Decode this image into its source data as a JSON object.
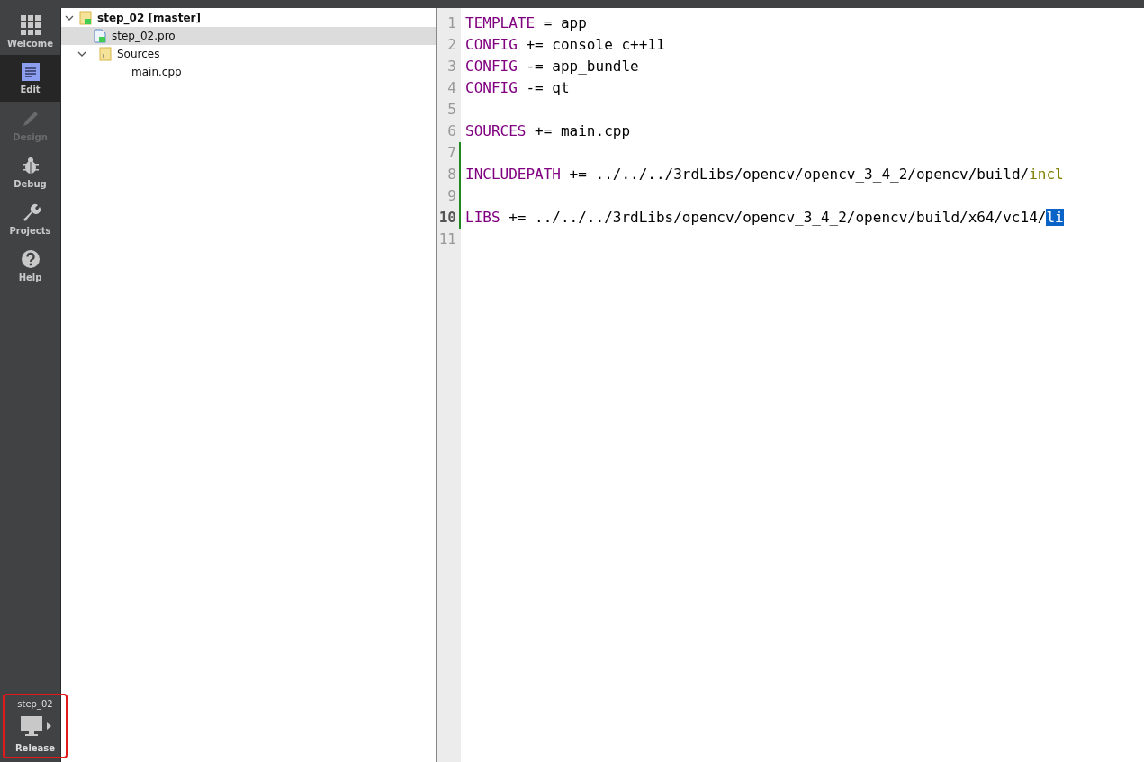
{
  "modes": [
    {
      "label": "Welcome",
      "kind": "grid",
      "selected": false,
      "disabled": false
    },
    {
      "label": "Edit",
      "kind": "edit",
      "selected": true,
      "disabled": false
    },
    {
      "label": "Design",
      "kind": "pencil",
      "selected": false,
      "disabled": true
    },
    {
      "label": "Debug",
      "kind": "bug",
      "selected": false,
      "disabled": false
    },
    {
      "label": "Projects",
      "kind": "wrench",
      "selected": false,
      "disabled": false
    },
    {
      "label": "Help",
      "kind": "help",
      "selected": false,
      "disabled": false
    }
  ],
  "kit": {
    "project": "step_02",
    "build": "Release",
    "highlighted": true
  },
  "project_tree": [
    {
      "label": "step_02 [master]",
      "expanded": true,
      "selected": false,
      "children": [
        {
          "label": "step_02.pro",
          "kind": "file",
          "selected": true
        },
        {
          "label": "Sources",
          "kind": "folder",
          "expanded": true,
          "selected": false,
          "children": [
            {
              "label": "main.cpp",
              "selected": false
            }
          ]
        }
      ]
    }
  ],
  "editor": {
    "lines": [
      {
        "number": "1",
        "current": false,
        "changed": false,
        "segments": [
          {
            "kind": "keyword",
            "text": "TEMPLATE"
          },
          {
            "kind": "plain",
            "text": " = app"
          }
        ]
      },
      {
        "number": "2",
        "current": false,
        "changed": false,
        "segments": [
          {
            "kind": "keyword",
            "text": "CONFIG"
          },
          {
            "kind": "plain",
            "text": " += console c++11"
          }
        ]
      },
      {
        "number": "3",
        "current": false,
        "changed": false,
        "segments": [
          {
            "kind": "keyword",
            "text": "CONFIG"
          },
          {
            "kind": "plain",
            "text": " -= app_bundle"
          }
        ]
      },
      {
        "number": "4",
        "current": false,
        "changed": false,
        "segments": [
          {
            "kind": "keyword",
            "text": "CONFIG"
          },
          {
            "kind": "plain",
            "text": " -= qt"
          }
        ]
      },
      {
        "number": "5",
        "current": false,
        "changed": false
      },
      {
        "number": "6",
        "current": false,
        "changed": false,
        "segments": [
          {
            "kind": "keyword",
            "text": "SOURCES"
          },
          {
            "kind": "plain",
            "text": " += main.cpp"
          }
        ]
      },
      {
        "number": "7",
        "current": false,
        "changed": true
      },
      {
        "number": "8",
        "current": false,
        "changed": true,
        "segments": [
          {
            "kind": "keyword",
            "text": "INCLUDEPATH"
          },
          {
            "kind": "plain",
            "text": " += ../../../3rdLibs/opencv/opencv_3_4_2/opencv/build/"
          },
          {
            "kind": "match",
            "text": "incl"
          }
        ]
      },
      {
        "number": "9",
        "current": false,
        "changed": true
      },
      {
        "number": "10",
        "current": true,
        "changed": true,
        "segments": [
          {
            "kind": "keyword",
            "text": "LIBS"
          },
          {
            "kind": "plain",
            "text": " += ../../../3rdLibs/opencv/opencv_3_4_2/opencv/build/x64/vc14/"
          },
          {
            "kind": "selection",
            "text": "li"
          }
        ]
      },
      {
        "number": "11",
        "current": false,
        "changed": false
      }
    ]
  }
}
